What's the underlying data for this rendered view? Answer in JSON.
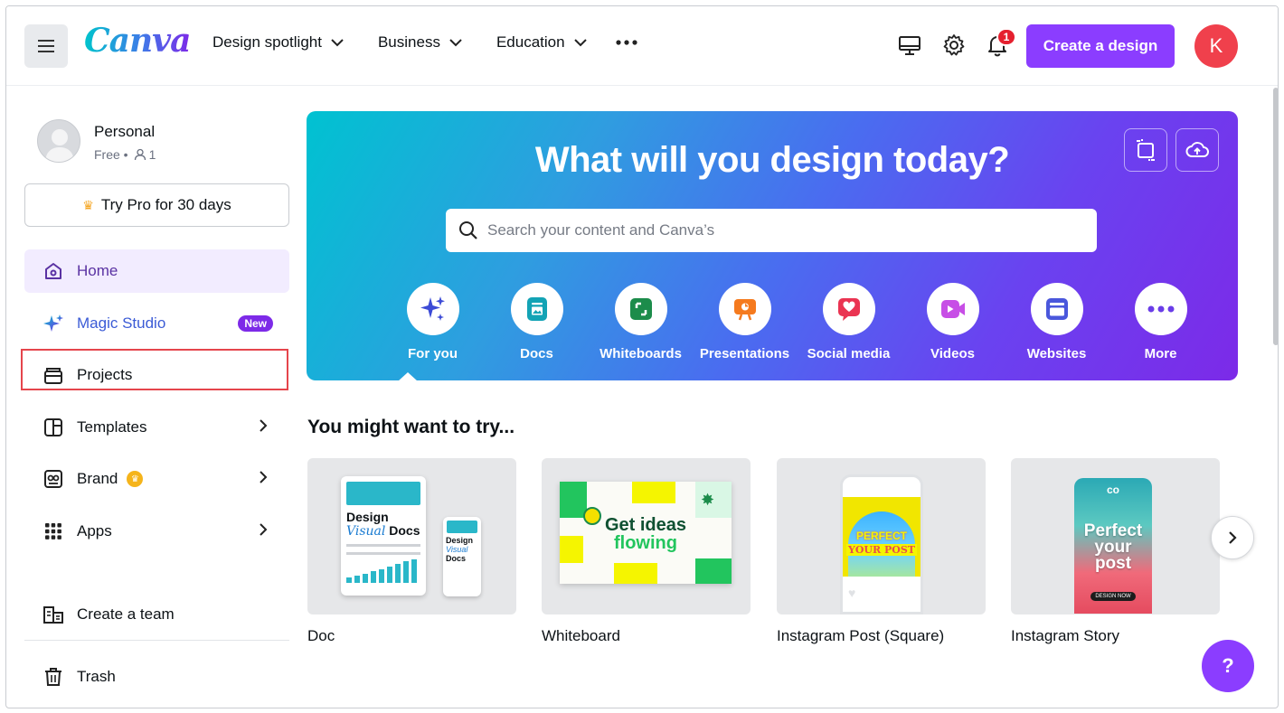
{
  "header": {
    "logo": "Canva",
    "nav": [
      {
        "label": "Design spotlight"
      },
      {
        "label": "Business"
      },
      {
        "label": "Education"
      }
    ],
    "notification_count": "1",
    "create_label": "Create a design",
    "avatar_initial": "K"
  },
  "sidebar": {
    "profile_name": "Personal",
    "profile_plan": "Free •",
    "member_count": "1",
    "trypro_label": "Try Pro for 30 days",
    "items": [
      {
        "label": "Home"
      },
      {
        "label": "Magic Studio",
        "badge": "New"
      },
      {
        "label": "Projects"
      },
      {
        "label": "Templates"
      },
      {
        "label": "Brand"
      },
      {
        "label": "Apps"
      },
      {
        "label": "Create a team"
      },
      {
        "label": "Trash"
      }
    ]
  },
  "hero": {
    "title": "What will you design today?",
    "search_placeholder": "Search your content and Canva’s",
    "categories": [
      {
        "label": "For you",
        "icon": "sparkle-icon"
      },
      {
        "label": "Docs",
        "icon": "doc-icon"
      },
      {
        "label": "Whiteboards",
        "icon": "whiteboard-icon"
      },
      {
        "label": "Presentations",
        "icon": "presentation-icon"
      },
      {
        "label": "Social media",
        "icon": "heart-icon"
      },
      {
        "label": "Videos",
        "icon": "video-icon"
      },
      {
        "label": "Websites",
        "icon": "website-icon"
      },
      {
        "label": "More",
        "icon": "more-icon"
      }
    ]
  },
  "try_section": {
    "title": "You might want to try...",
    "cards": [
      {
        "label": "Doc",
        "thumb_text_1": "Design",
        "thumb_text_2": "Visual",
        "thumb_text_3": "Docs"
      },
      {
        "label": "Whiteboard",
        "thumb_text_1": "Get ideas",
        "thumb_text_2": "flowing"
      },
      {
        "label": "Instagram Post (Square)",
        "thumb_text_1": "PERFECT",
        "thumb_text_2": "YOUR POST"
      },
      {
        "label": "Instagram Story",
        "thumb_text_1": "Perfect",
        "thumb_text_2": "your",
        "thumb_text_3": "post",
        "thumb_text_4": "DESIGN NOW",
        "thumb_text_5": "co"
      }
    ]
  },
  "help_label": "?"
}
